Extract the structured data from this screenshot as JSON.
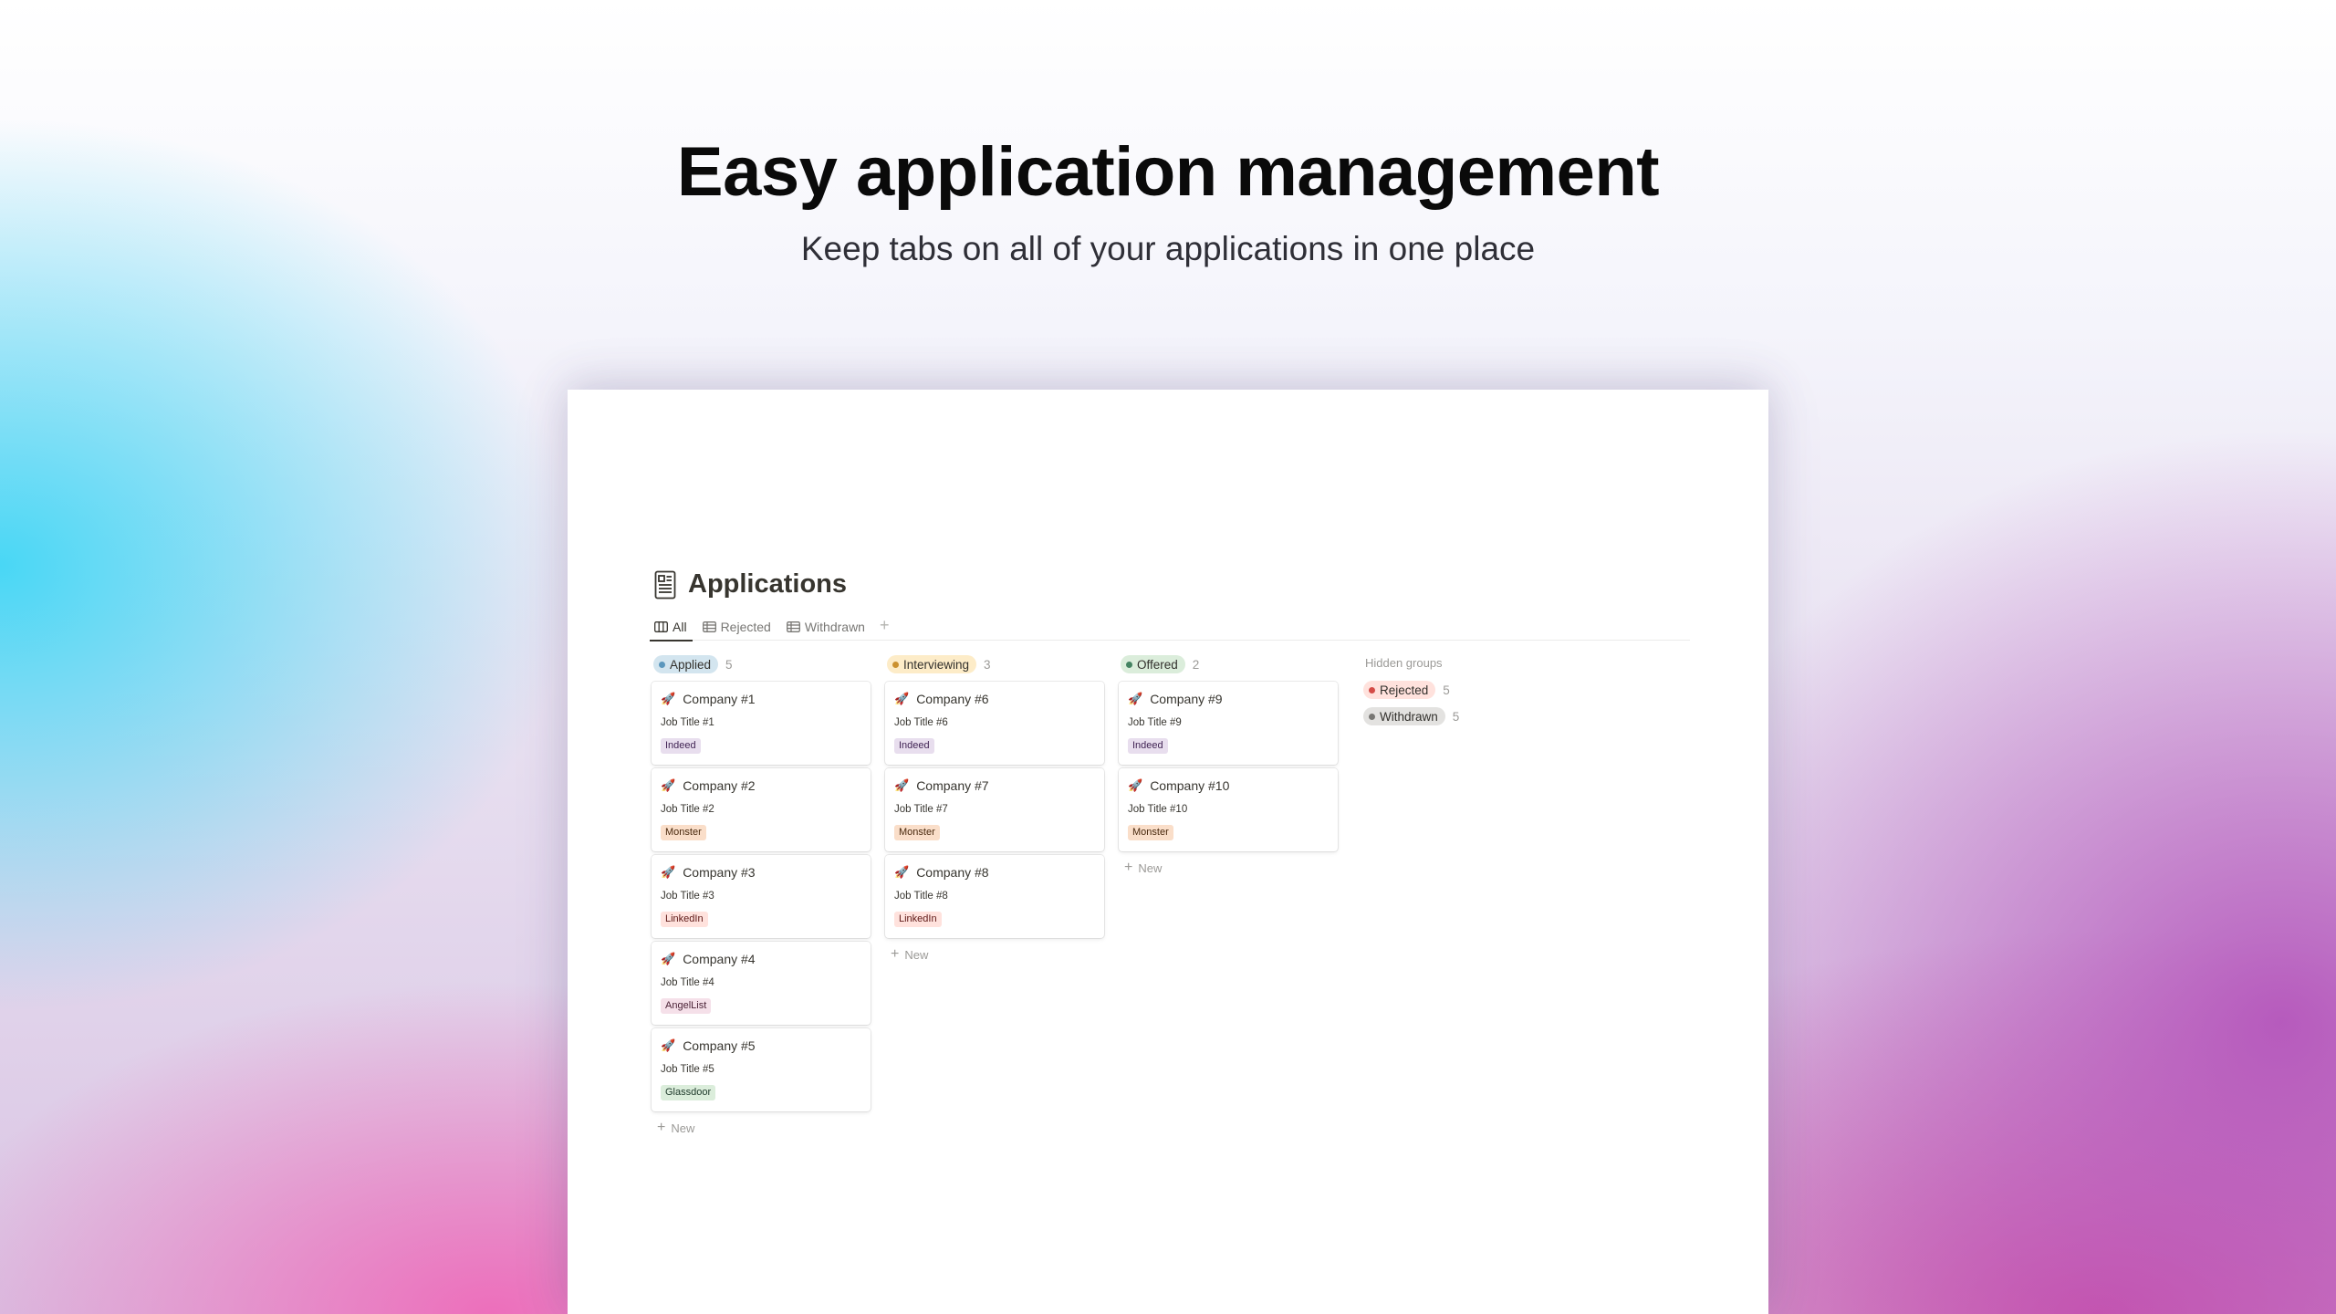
{
  "hero": {
    "title": "Easy application management",
    "subtitle": "Keep tabs on all of your applications in one place"
  },
  "database": {
    "title": "Applications",
    "icon": "document-list-icon",
    "tabs": [
      {
        "label": "All",
        "icon": "board-icon",
        "active": true
      },
      {
        "label": "Rejected",
        "icon": "table-icon",
        "active": false
      },
      {
        "label": "Withdrawn",
        "icon": "table-icon",
        "active": false
      }
    ],
    "add_view": "+"
  },
  "columns": [
    {
      "label": "Applied",
      "count": "5",
      "bg": "#d3e5ef",
      "dot": "#5b97bd",
      "cards": [
        {
          "emoji": "🚀",
          "company": "Company #1",
          "job": "Job Title #1",
          "source": "Indeed",
          "tag_bg": "#e8deee",
          "tag_fg": "#412454"
        },
        {
          "emoji": "🚀",
          "company": "Company #2",
          "job": "Job Title #2",
          "source": "Monster",
          "tag_bg": "#fadec9",
          "tag_fg": "#49290e"
        },
        {
          "emoji": "🚀",
          "company": "Company #3",
          "job": "Job Title #3",
          "source": "LinkedIn",
          "tag_bg": "#ffe2dd",
          "tag_fg": "#5d1715"
        },
        {
          "emoji": "🚀",
          "company": "Company #4",
          "job": "Job Title #4",
          "source": "AngelList",
          "tag_bg": "#f5e0e9",
          "tag_fg": "#4c2337"
        },
        {
          "emoji": "🚀",
          "company": "Company #5",
          "job": "Job Title #5",
          "source": "Glassdoor",
          "tag_bg": "#dbeddb",
          "tag_fg": "#1c3829"
        }
      ],
      "new_label": "New"
    },
    {
      "label": "Interviewing",
      "count": "3",
      "bg": "#fdecc8",
      "dot": "#cb912f",
      "cards": [
        {
          "emoji": "🚀",
          "company": "Company #6",
          "job": "Job Title #6",
          "source": "Indeed",
          "tag_bg": "#e8deee",
          "tag_fg": "#412454"
        },
        {
          "emoji": "🚀",
          "company": "Company #7",
          "job": "Job Title #7",
          "source": "Monster",
          "tag_bg": "#fadec9",
          "tag_fg": "#49290e"
        },
        {
          "emoji": "🚀",
          "company": "Company #8",
          "job": "Job Title #8",
          "source": "LinkedIn",
          "tag_bg": "#ffe2dd",
          "tag_fg": "#5d1715"
        }
      ],
      "new_label": "New"
    },
    {
      "label": "Offered",
      "count": "2",
      "bg": "#dbeddb",
      "dot": "#448361",
      "cards": [
        {
          "emoji": "🚀",
          "company": "Company #9",
          "job": "Job Title #9",
          "source": "Indeed",
          "tag_bg": "#e8deee",
          "tag_fg": "#412454"
        },
        {
          "emoji": "🚀",
          "company": "Company #10",
          "job": "Job Title #10",
          "source": "Monster",
          "tag_bg": "#fadec9",
          "tag_fg": "#49290e"
        }
      ],
      "new_label": "New"
    }
  ],
  "hidden_groups": {
    "label": "Hidden groups",
    "items": [
      {
        "label": "Rejected",
        "count": "5",
        "bg": "#ffe2dd",
        "dot": "#d44c47"
      },
      {
        "label": "Withdrawn",
        "count": "5",
        "bg": "#e3e2e0",
        "dot": "#787774"
      }
    ]
  }
}
